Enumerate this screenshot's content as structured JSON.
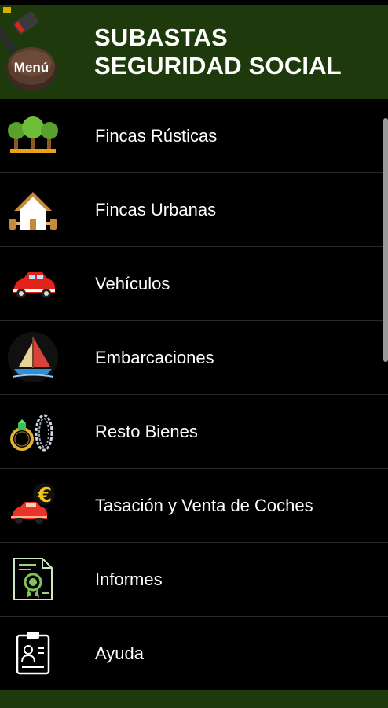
{
  "header": {
    "title": "SUBASTAS SEGURIDAD SOCIAL",
    "menu_label": "Menú",
    "background": "#1e3a0c"
  },
  "menu_items": [
    {
      "label": "Fincas Rústicas",
      "icon": "trees-icon"
    },
    {
      "label": "Fincas Urbanas",
      "icon": "house-icon"
    },
    {
      "label": "Vehículos",
      "icon": "car-icon"
    },
    {
      "label": "Embarcaciones",
      "icon": "sailboat-icon"
    },
    {
      "label": "Resto Bienes",
      "icon": "jewelry-icon"
    },
    {
      "label": "Tasación y Venta de Coches",
      "icon": "car-euro-icon"
    },
    {
      "label": "Informes",
      "icon": "certificate-icon"
    },
    {
      "label": "Ayuda",
      "icon": "help-clipboard-icon"
    }
  ],
  "colors": {
    "header_bg": "#1e3a0c",
    "list_bg": "#000000",
    "text": "#ffffff",
    "divider": "#2a2a2a"
  }
}
